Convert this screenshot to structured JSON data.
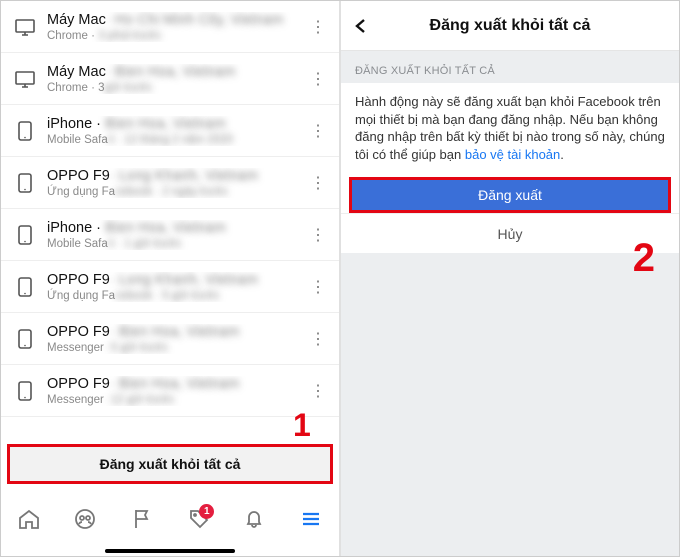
{
  "annotations": {
    "one": "1",
    "two": "2"
  },
  "left": {
    "sessions": [
      {
        "device_class": "monitor",
        "title_prefix": "Máy Mac",
        "title_blur": "· Ho Chi Minh City, Vietnam",
        "sub_prefix": "Chrome · ",
        "sub_blur": "3 phút trước"
      },
      {
        "device_class": "monitor",
        "title_prefix": "Máy Mac",
        "title_blur": "· Bien Hoa, Vietnam",
        "sub_prefix": "Chrome · 3",
        "sub_blur": " giờ trước"
      },
      {
        "device_class": "phone",
        "title_prefix": "iPhone · ",
        "title_blur": "Bien Hoa, Vietnam",
        "sub_prefix": "Mobile Safa",
        "sub_blur": "ri · 12 tháng 2 năm 2020"
      },
      {
        "device_class": "phone",
        "title_prefix": "OPPO F9",
        "title_blur": " · Long Khanh, Vietnam",
        "sub_prefix": "Ứng dụng Fa",
        "sub_blur": "cebook · 2 ngày trước"
      },
      {
        "device_class": "phone",
        "title_prefix": "iPhone · ",
        "title_blur": "Bien Hoa, Vietnam",
        "sub_prefix": "Mobile Safa",
        "sub_blur": "ri · 1 giờ trước"
      },
      {
        "device_class": "phone",
        "title_prefix": "OPPO F9",
        "title_blur": " · Long Khanh, Vietnam",
        "sub_prefix": "Ứng dụng Fa",
        "sub_blur": "cebook · 5 giờ trước"
      },
      {
        "device_class": "phone",
        "title_prefix": "OPPO F9",
        "title_blur": " · Bien Hoa, Vietnam",
        "sub_prefix": "Messenger",
        "sub_blur": " · 5 giờ trước"
      },
      {
        "device_class": "phone",
        "title_prefix": "OPPO F9",
        "title_blur": " · Bien Hoa, Vietnam",
        "sub_prefix": "Messenger",
        "sub_blur": " · 12 giờ trước"
      }
    ],
    "logout_all": "Đăng xuất khỏi tất cả",
    "nav": {
      "badge": "1"
    }
  },
  "right": {
    "header_title": "Đăng xuất khỏi tất cả",
    "section_caption": "ĐĂNG XUẤT KHỎI TẤT CẢ",
    "paragraph_a": "Hành động này sẽ đăng xuất bạn khỏi Facebook trên mọi thiết bị mà bạn đang đăng nhập. Nếu bạn không đăng nhập trên bất kỳ thiết bị nào trong số này, chúng tôi có thể giúp bạn ",
    "paragraph_link": "bảo vệ tài khoản",
    "paragraph_b": ".",
    "confirm": "Đăng xuất",
    "cancel": "Hủy"
  }
}
